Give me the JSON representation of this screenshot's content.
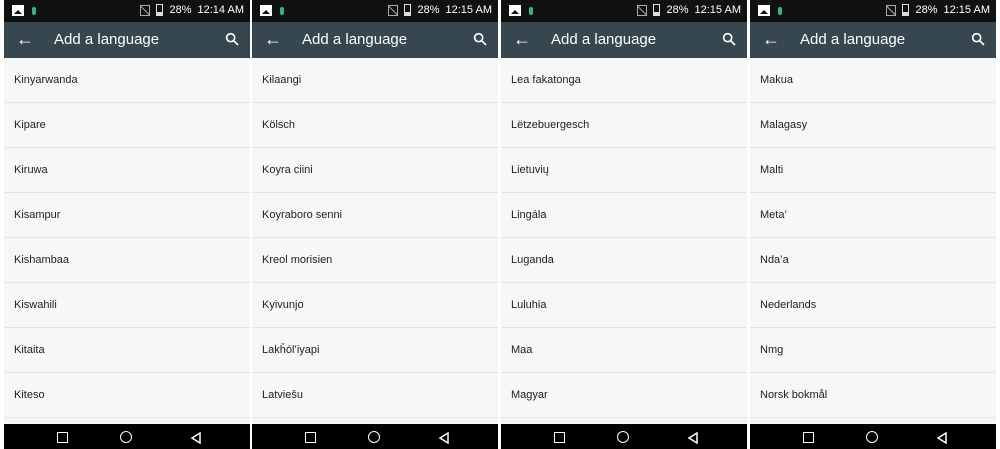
{
  "panels": [
    {
      "status": {
        "battery": "28%",
        "time": "12:14 AM"
      },
      "title": "Add a language",
      "items": [
        "Kinyarwanda",
        "Kipare",
        "Kiruwa",
        "Kisampur",
        "Kishambaa",
        "Kiswahili",
        "Kitaita",
        "Kiteso"
      ]
    },
    {
      "status": {
        "battery": "28%",
        "time": "12:15 AM"
      },
      "title": "Add a language",
      "items": [
        "Kɨlaangi",
        "Kölsch",
        "Koyra ciini",
        "Koyraboro senni",
        "Kreol morisien",
        "Kyivunjo",
        "Lakȟól’iyapi",
        "Latviešu"
      ]
    },
    {
      "status": {
        "battery": "28%",
        "time": "12:15 AM"
      },
      "title": "Add a language",
      "items": [
        "Lea fakatonga",
        "Lëtzebuergesch",
        "Lietuvių",
        "Lingála",
        "Luganda",
        "Luluhia",
        "Maa",
        "Magyar"
      ]
    },
    {
      "status": {
        "battery": "28%",
        "time": "12:15 AM"
      },
      "title": "Add a language",
      "items": [
        "Makua",
        "Malagasy",
        "Malti",
        "Meta’",
        "Nda’a",
        "Nederlands",
        "Nmg",
        "Norsk bokmål"
      ]
    }
  ],
  "colors": {
    "toolbar": "#37474f",
    "statusbar": "#111111",
    "navbar": "#000000"
  }
}
